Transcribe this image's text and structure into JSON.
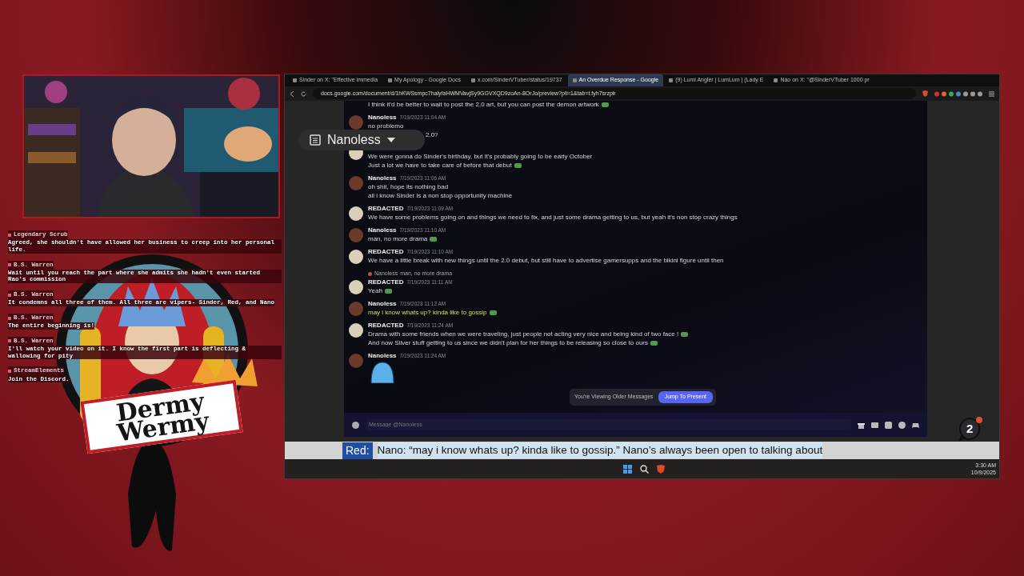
{
  "chat": [
    {
      "author": "Legendary Scrub",
      "text": "Agreed, she shouldn't have allowed her business to creep into her personal life."
    },
    {
      "author": "B.S. Warren",
      "text": "Wait until you reach the part where she admits she hadn't even started Rao's commission"
    },
    {
      "author": "B.S. Warren",
      "text": "It condemns all three of them. All three are vipers- Sinder, Red, and Nano"
    },
    {
      "author": "B.S. Warren",
      "text": "The entire beginning is!"
    },
    {
      "author": "B.S. Warren",
      "text": "I'll watch your video on it. I know the first part is deflecting & wallowing for pity"
    },
    {
      "author": "StreamElements",
      "text": "Join the Discord."
    }
  ],
  "logo": {
    "line1": "Dermy",
    "line2": "Wermy"
  },
  "browser": {
    "tabs": [
      {
        "title": "Sinder on X: \"Effective immedia",
        "selected": false
      },
      {
        "title": "My Apology - Google Docs",
        "selected": false
      },
      {
        "title": "x.com/SinderVTuber/status/19737",
        "selected": false
      },
      {
        "title": "An Overdue Response - Google",
        "selected": true
      },
      {
        "title": "(9) Lumi Angler | LumLum | (Lady E",
        "selected": false
      },
      {
        "title": "Nao on X: \"@SinderVTuber 1000 pr",
        "selected": false
      }
    ],
    "url": "docs.google.com/document/d/1hKWSsmpc7halyfaHWMVavjSy9GGVXQD9zoAn-8OrJo/preview?pli=1&tab=t.fyh7srzpir",
    "outline_pill": "Nanoless",
    "discord": {
      "messages": [
        {
          "kind": "continuation",
          "lines": [
            {
              "text": "I think it'd be better to wait to post the 2.0 art, but you can post the demon artwork",
              "emoji": true
            }
          ]
        },
        {
          "kind": "full",
          "author": "Nanoless",
          "time": "7/19/2023 11:04 AM",
          "color": "#6b3a2a",
          "lines": [
            {
              "text": "no problemo"
            },
            {
              "text": "2.0?",
              "kind": "cut"
            }
          ]
        },
        {
          "kind": "hidden_header",
          "color": "#d8d0b8",
          "lines": [
            {
              "text": "We were gonna do Sinder's birthday, but it's probably going to be early October"
            },
            {
              "text": "Just a lot we have to take care of before that debut",
              "emoji": true
            }
          ]
        },
        {
          "kind": "full",
          "author": "Nanoless",
          "time": "7/19/2023 11:06 AM",
          "color": "#6b3a2a",
          "lines": [
            {
              "text": "oh shit, hope its nothing bad"
            },
            {
              "text": "all i know Sinder is a non stop opportunity machine"
            }
          ]
        },
        {
          "kind": "full",
          "author": "REDACTED",
          "time": "7/19/2023 11:09 AM",
          "color": "#d8d0b8",
          "lines": [
            {
              "text": "We have some problems going on and things we need to fix, and just some drama getting to us, but yeah it's non stop crazy things"
            }
          ]
        },
        {
          "kind": "full",
          "author": "Nanoless",
          "time": "7/19/2023 11:10 AM",
          "color": "#6b3a2a",
          "lines": [
            {
              "text": "man, no more drama",
              "emoji": true
            }
          ]
        },
        {
          "kind": "full",
          "author": "REDACTED",
          "time": "7/19/2023 11:10 AM",
          "color": "#d8d0b8",
          "lines": [
            {
              "text": "We have a little break with new things until the 2.0 debut, but still have to advertise gamersupps and the bikini figure until then"
            }
          ]
        },
        {
          "kind": "full",
          "author": "REDACTED",
          "time": "7/19/2023 11:11 AM",
          "color": "#d8d0b8",
          "reply": {
            "author": "Nanoless",
            "text": "man, no more drama"
          },
          "lines": [
            {
              "text": "Yeah",
              "emoji": true
            }
          ]
        },
        {
          "kind": "full",
          "author": "Nanoless",
          "time": "7/19/2023 11:12 AM",
          "color": "#6b3a2a",
          "lines": [
            {
              "text": "may i know whats up? kinda like to gossip",
              "emoji": true,
              "highlighted": true
            }
          ]
        },
        {
          "kind": "full",
          "author": "REDACTED",
          "time": "7/19/2023 11:24 AM",
          "color": "#d8d0b8",
          "lines": [
            {
              "text": "Drama with some friends when we were traveling, just people not acting very nice and being kind of two face !",
              "emoji": true
            },
            {
              "text": "And now Silver stuff getting to us since we didn't plan for her things to be releasing so close to ours",
              "emoji": true
            }
          ]
        },
        {
          "kind": "full",
          "author": "Nanoless",
          "time": "7/19/2023 11:24 AM",
          "color": "#6b3a2a",
          "sticker": true
        }
      ],
      "older_notice": "You're Viewing Older Messages",
      "jump_button": "Jump To Present",
      "composer": {
        "placeholder": "Message @Nanoless"
      }
    },
    "notification_count": "2",
    "caption": {
      "speaker": "Red:",
      "text": "Nano: “may i know whats up? kinda like to gossip.” Nano’s always been open to talking about"
    },
    "taskbar": {
      "time": "3:30 AM",
      "date": "10/9/2025"
    }
  }
}
